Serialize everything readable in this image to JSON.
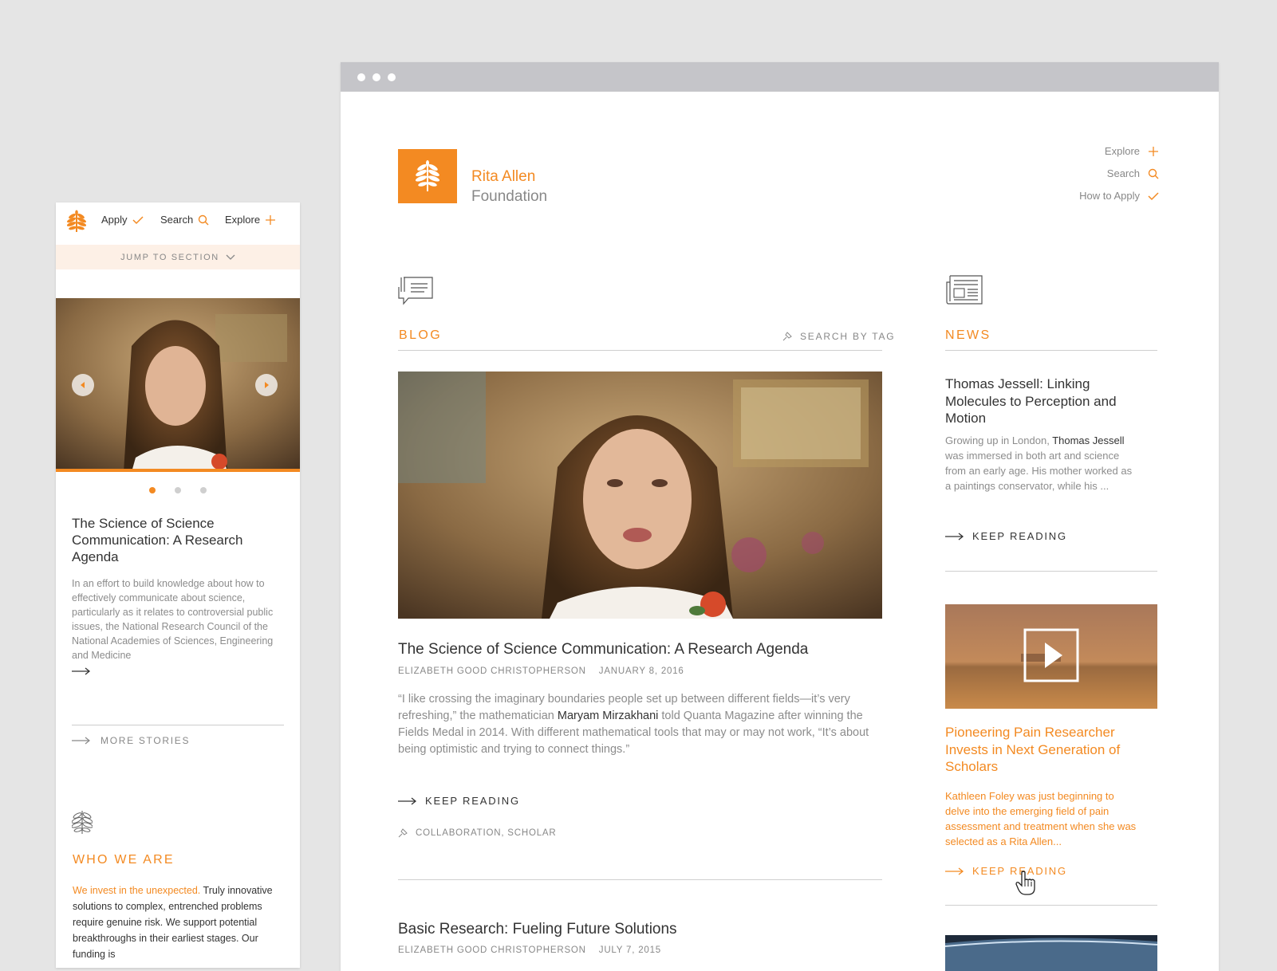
{
  "colors": {
    "accent": "#f38a22",
    "text": "#333333",
    "muted": "#8c8c8c",
    "background": "#e5e5e5"
  },
  "mobile": {
    "nav": {
      "apply": "Apply",
      "search": "Search",
      "explore": "Explore"
    },
    "jump_to_section": "JUMP TO SECTION",
    "slider_dots": 3,
    "active_dot": 1,
    "story_title": "The Science of Science Communication: A Research Agenda",
    "story_excerpt": "In an effort to build knowledge about how to effectively communicate about science, particularly as it relates to controversial public issues, the National Research Council of the National Academies of Sciences, Engineering and Medicine",
    "more_stories": "MORE STORIES",
    "who_we_are": {
      "heading": "WHO WE ARE",
      "highlight": "We invest in the unexpected.",
      "text": " Truly innovative solutions to complex, entrenched problems require genuine risk. We support potential breakthroughs in their earliest stages. Our funding is"
    }
  },
  "desktop": {
    "brand": {
      "line1": "Rita Allen",
      "line2": "Foundation"
    },
    "nav": {
      "explore": "Explore",
      "search": "Search",
      "how_to_apply": "How to Apply"
    },
    "blog": {
      "heading": "BLOG",
      "search_by_tag": "SEARCH BY TAG",
      "post1": {
        "title": "The Science of Science Communication: A Research Agenda",
        "author": "ELIZABETH GOOD CHRISTOPHERSON",
        "date": "JANUARY 8, 2016",
        "quote_part1": "“I like crossing the imaginary boundaries people set up between different fields—it’s very refreshing,” the mathematician ",
        "quote_name": "Maryam Mirzakhani",
        "quote_part2": " told Quanta Magazine after winning the Fields Medal in 2014. With different mathematical tools that may or may not work, “It’s about being optimistic and trying to connect things.”",
        "keep_reading": "KEEP READING",
        "tags": "COLLABORATION, SCHOLAR"
      },
      "post2": {
        "title": "Basic Research: Fueling Future Solutions",
        "author": "ELIZABETH GOOD CHRISTOPHERSON",
        "date": "JULY 7, 2015"
      }
    },
    "news": {
      "heading": "NEWS",
      "item1": {
        "title": "Thomas Jessell: Linking Molecules to Perception and Motion",
        "text_part1": "Growing up in London, ",
        "text_name": "Thomas Jessell",
        "text_part2": " was immersed in both art and science from an early age. His mother worked as a paintings conservator, while his ...",
        "keep_reading": "KEEP READING"
      },
      "item2": {
        "title": "Pioneering Pain Researcher Invests in Next Generation of Scholars",
        "text": "Kathleen Foley was just beginning to delve into the emerging field of pain assessment and treatment when she was selected as a Rita Allen...",
        "keep_reading": "KEEP READING"
      }
    }
  }
}
